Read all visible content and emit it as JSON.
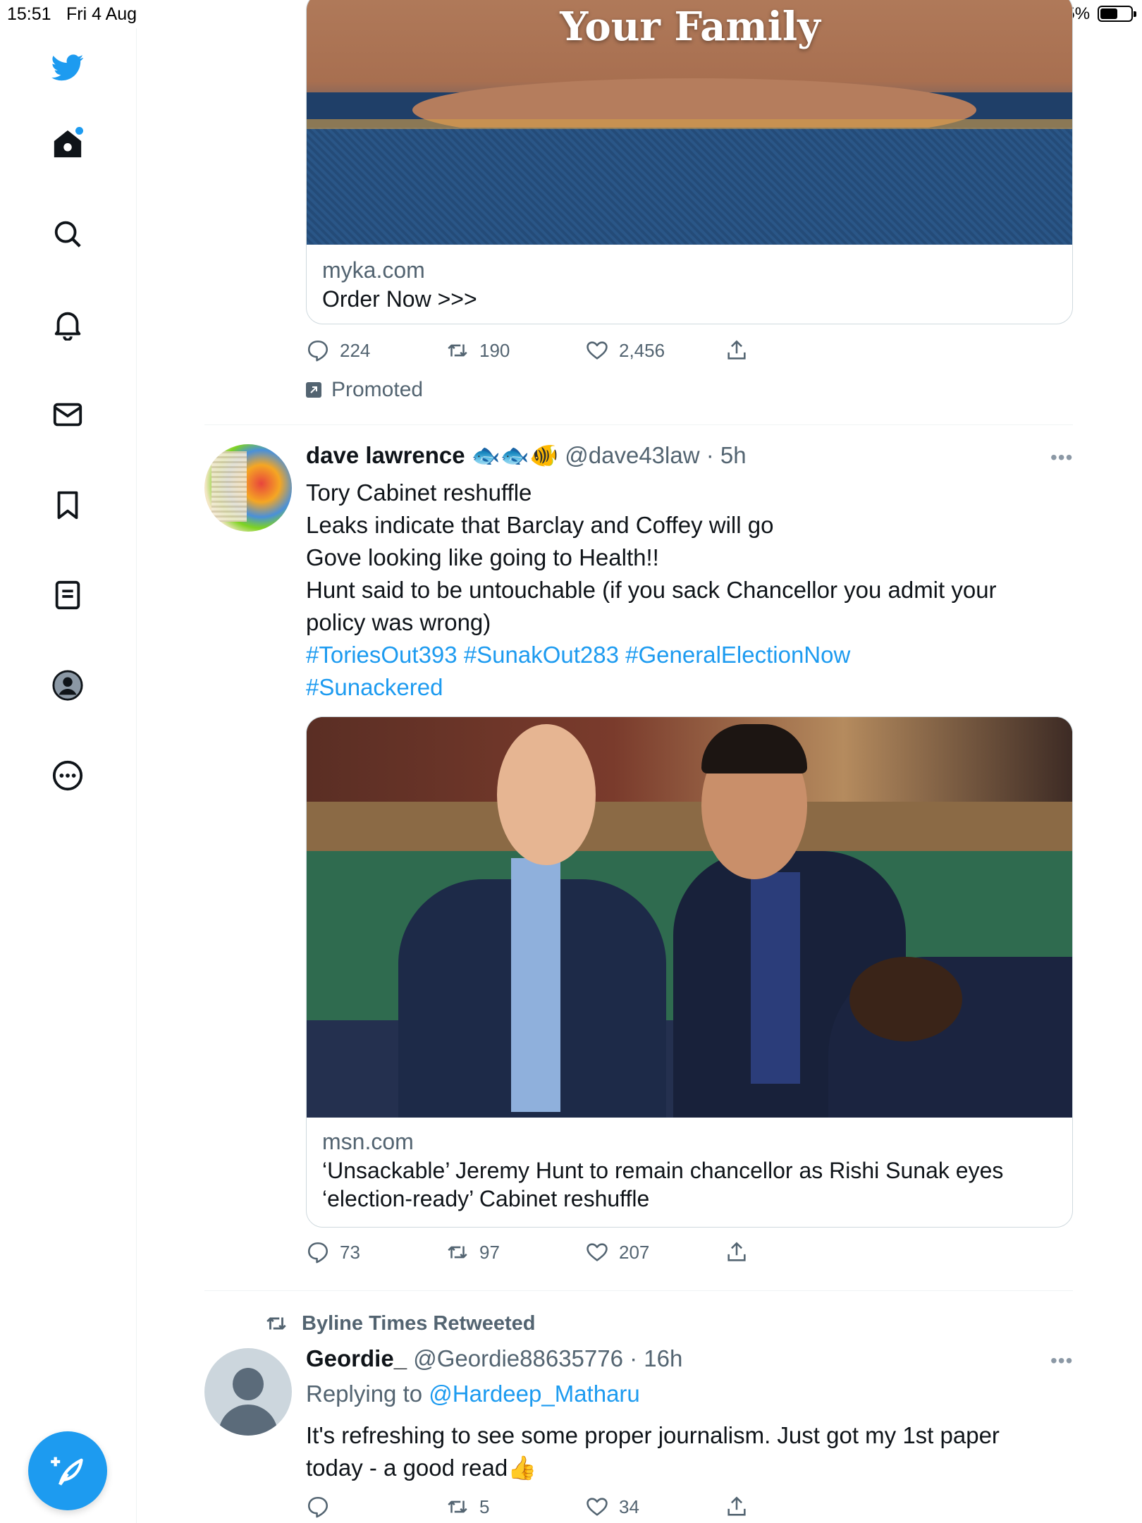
{
  "status_bar": {
    "time": "15:51",
    "date": "Fri 4 Aug",
    "battery": "55%",
    "dots": "•••"
  },
  "nav": {
    "items": [
      "twitter-logo",
      "home",
      "search",
      "notifications",
      "messages",
      "bookmarks",
      "lists",
      "profile",
      "more"
    ],
    "accent_color": "#1d9bf0"
  },
  "ad_tweet": {
    "image_text": "Your Family",
    "card_domain": "myka.com",
    "card_title": "Order Now >>>",
    "replies": "224",
    "retweets": "190",
    "likes": "2,456",
    "promoted_label": "Promoted"
  },
  "tweet1": {
    "name": "dave lawrence",
    "emojis": "🐟🐟🐠",
    "handle": "@dave43law",
    "time": "· 5h",
    "more": "•••",
    "lines": [
      "Tory Cabinet reshuffle",
      "Leaks indicate that Barclay and Coffey will go",
      "Gove looking like going to Health!!",
      "Hunt said to be untouchable (if you sack Chancellor you admit your policy was wrong)"
    ],
    "hashtags": [
      "#ToriesOut393",
      "#SunakOut283",
      "#GeneralElectionNow",
      "#Sunackered"
    ],
    "card_domain": "msn.com",
    "card_title": "‘Unsackable’ Jeremy Hunt to remain chancellor as Rishi Sunak eyes ‘election-ready’ Cabinet reshuffle",
    "replies": "73",
    "retweets": "97",
    "likes": "207"
  },
  "tweet2": {
    "retweeted_by": "Byline Times Retweeted",
    "name": "Geordie_",
    "handle": "@Geordie88635776",
    "time": "· 16h",
    "more": "•••",
    "replying_prefix": "Replying to",
    "replying_to": "@Hardeep_Matharu",
    "text": "It's refreshing to see some proper journalism. Just got my 1st paper today - a good read👍",
    "retweets": "5",
    "likes": "34"
  }
}
